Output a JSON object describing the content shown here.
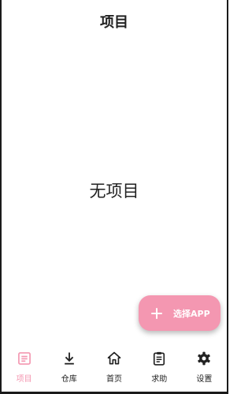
{
  "header": {
    "title": "项目"
  },
  "main": {
    "empty_text": "无项目"
  },
  "fab": {
    "label": "选择APP",
    "icon": "plus-icon"
  },
  "nav": {
    "active_color": "#f497b1",
    "items": [
      {
        "label": "项目",
        "icon": "list-icon",
        "active": true
      },
      {
        "label": "仓库",
        "icon": "download-icon",
        "active": false
      },
      {
        "label": "首页",
        "icon": "home-icon",
        "active": false
      },
      {
        "label": "求助",
        "icon": "clipboard-icon",
        "active": false
      },
      {
        "label": "设置",
        "icon": "gear-icon",
        "active": false
      }
    ]
  },
  "colors": {
    "accent": "#f497b1",
    "text": "#222222",
    "background": "#ffffff"
  }
}
